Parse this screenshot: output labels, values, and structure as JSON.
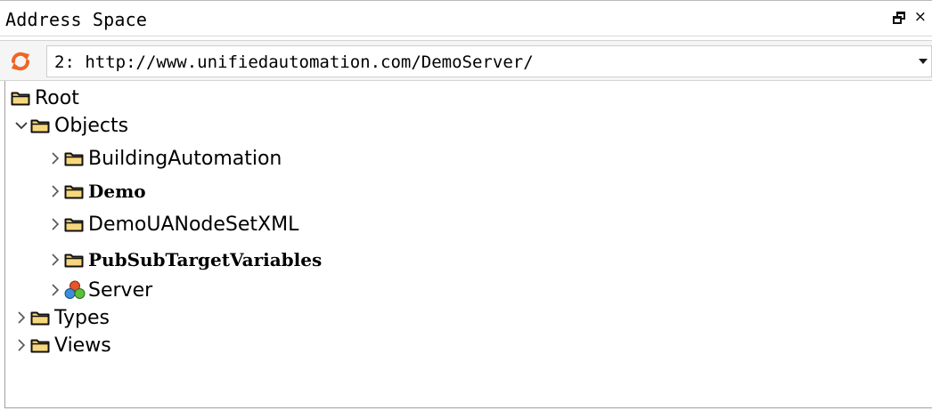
{
  "panel": {
    "title": "Address Space",
    "float_icon": "float-window-icon",
    "close_glyph": "×"
  },
  "address": {
    "refresh_icon": "refresh-icon",
    "selected_server": "2: http://www.unifiedautomation.com/DemoServer/",
    "dropdown_icon": "chevron-down-icon"
  },
  "tree": {
    "nodes": [
      {
        "label": "Root",
        "icon": "folder-icon",
        "expander": "none",
        "bold": false
      },
      {
        "label": "Objects",
        "icon": "folder-icon",
        "expander": "expanded",
        "bold": false
      },
      {
        "label": "BuildingAutomation",
        "icon": "folder-icon",
        "expander": "collapsed",
        "bold": false
      },
      {
        "label": "Demo",
        "icon": "folder-icon",
        "expander": "collapsed",
        "bold": true
      },
      {
        "label": "DemoUANodeSetXML",
        "icon": "folder-icon",
        "expander": "collapsed",
        "bold": false
      },
      {
        "label": "PubSubTargetVariables",
        "icon": "folder-icon",
        "expander": "collapsed",
        "bold": true
      },
      {
        "label": "Server",
        "icon": "server-object-icon",
        "expander": "collapsed",
        "bold": false
      },
      {
        "label": "Types",
        "icon": "folder-icon",
        "expander": "collapsed",
        "bold": false
      },
      {
        "label": "Views",
        "icon": "folder-icon",
        "expander": "collapsed",
        "bold": false
      }
    ]
  },
  "colors": {
    "folder_fill": "#f7d77c",
    "folder_outline": "#111111",
    "refresh_orange": "#f26522",
    "tree_border": "#a0a0a0"
  }
}
